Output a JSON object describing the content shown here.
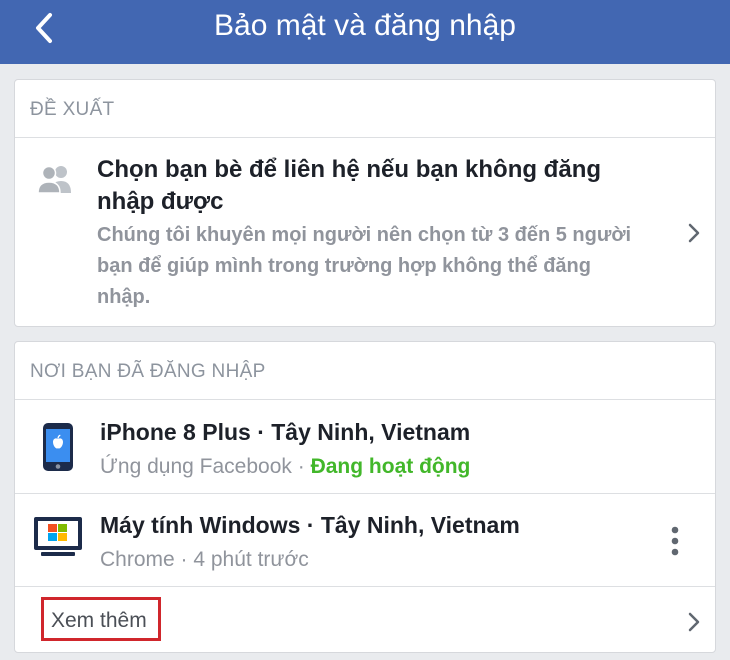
{
  "header": {
    "title": "Bảo mật và đăng nhập",
    "back_icon": "chevron-left-icon",
    "bg_color": "#4267b2"
  },
  "suggestion": {
    "section_label": "ĐỀ XUẤT",
    "icon": "people-icon",
    "title": "Chọn bạn bè để liên hệ nếu bạn không đăng nhập được",
    "description": "Chúng tôi khuyên mọi người nên chọn từ 3 đến 5 người bạn để giúp mình trong trường hợp không thể đăng nhập."
  },
  "logins": {
    "section_label": "NƠI BẠN ĐÃ ĐĂNG NHẬP",
    "devices": [
      {
        "icon": "iphone-icon",
        "name": "iPhone 8 Plus · Tây Ninh, Vietnam",
        "app": "Ứng dụng Facebook",
        "separator": " · ",
        "status": "Đang hoạt động",
        "status_color": "#42b72a"
      },
      {
        "icon": "windows-computer-icon",
        "name": "Máy tính Windows · Tây Ninh, Vietnam",
        "app": "Chrome · 4 phút trước"
      }
    ],
    "see_more": "Xem thêm"
  }
}
